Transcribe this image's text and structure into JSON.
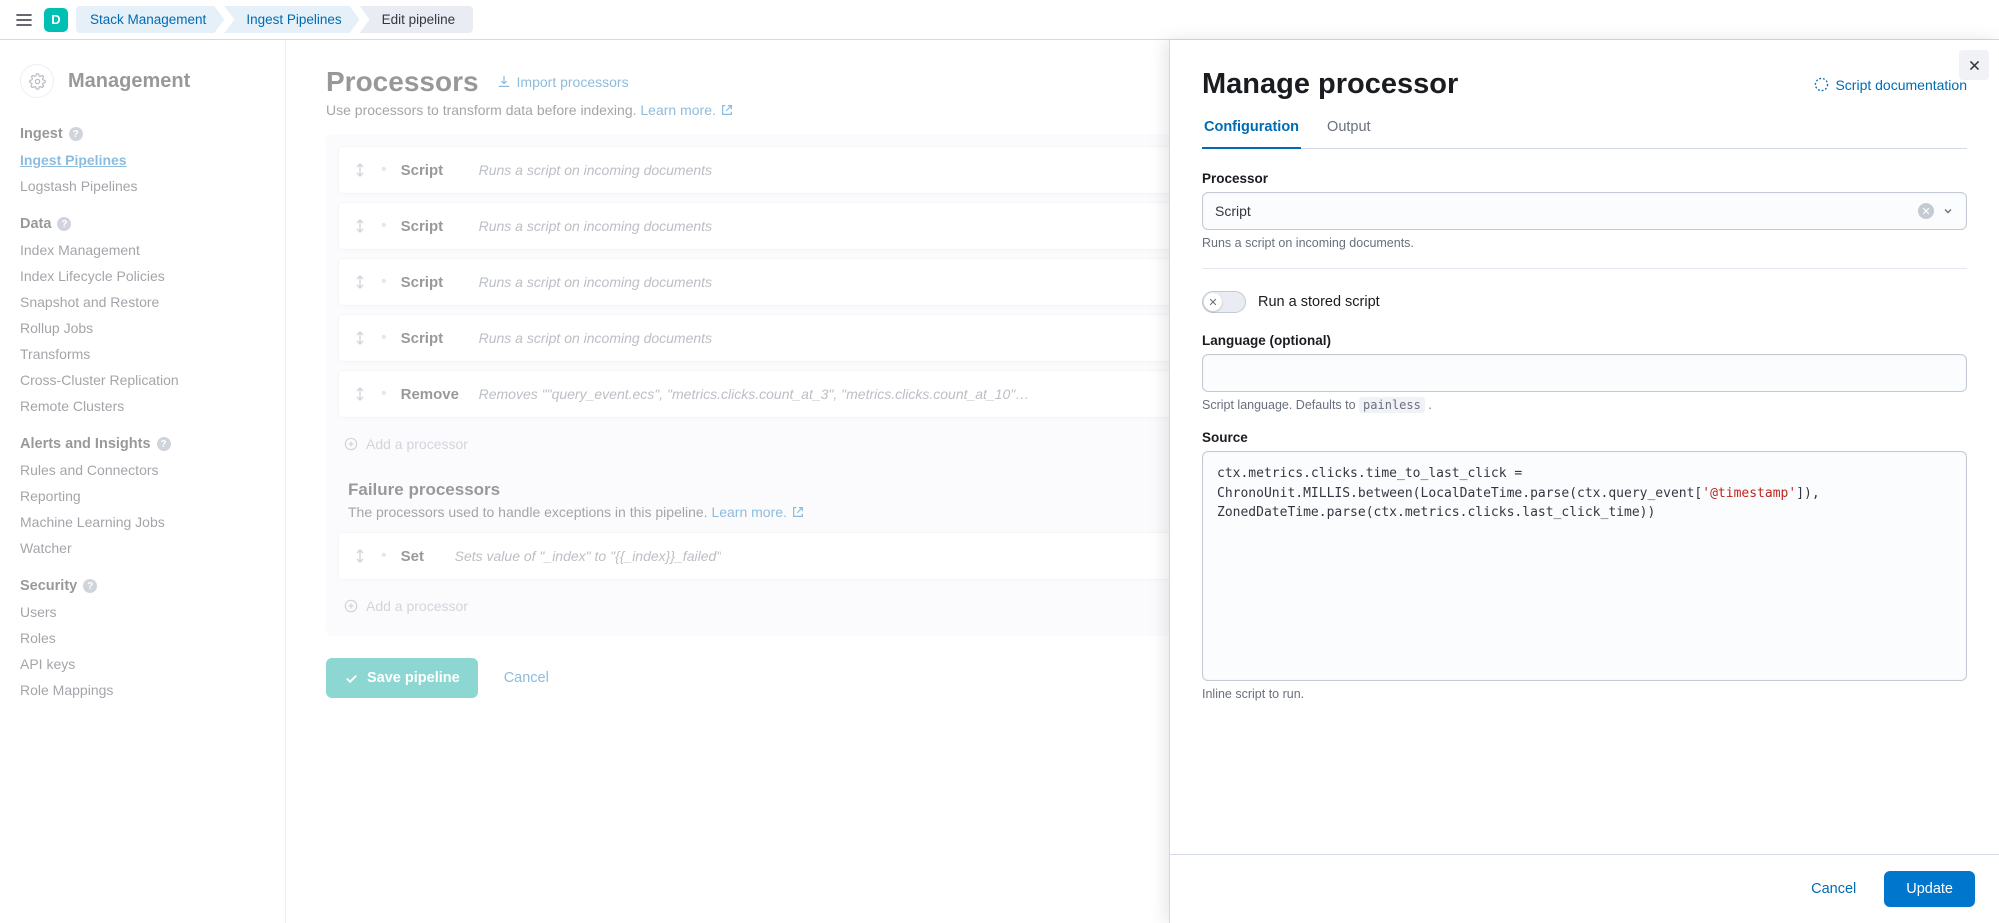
{
  "topnav": {
    "avatar_letter": "D",
    "crumbs": [
      "Stack Management",
      "Ingest Pipelines",
      "Edit pipeline"
    ]
  },
  "sidebar": {
    "title": "Management",
    "sections": [
      {
        "heading": "Ingest",
        "items": [
          {
            "label": "Ingest Pipelines",
            "active": true
          },
          {
            "label": "Logstash Pipelines"
          }
        ]
      },
      {
        "heading": "Data",
        "items": [
          {
            "label": "Index Management"
          },
          {
            "label": "Index Lifecycle Policies"
          },
          {
            "label": "Snapshot and Restore"
          },
          {
            "label": "Rollup Jobs"
          },
          {
            "label": "Transforms"
          },
          {
            "label": "Cross-Cluster Replication"
          },
          {
            "label": "Remote Clusters"
          }
        ]
      },
      {
        "heading": "Alerts and Insights",
        "items": [
          {
            "label": "Rules and Connectors"
          },
          {
            "label": "Reporting"
          },
          {
            "label": "Machine Learning Jobs"
          },
          {
            "label": "Watcher"
          }
        ]
      },
      {
        "heading": "Security",
        "items": [
          {
            "label": "Users"
          },
          {
            "label": "Roles"
          },
          {
            "label": "API keys"
          },
          {
            "label": "Role Mappings"
          }
        ]
      }
    ]
  },
  "main": {
    "title": "Processors",
    "import_label": "Import processors",
    "subtitle": "Use processors to transform data before indexing. ",
    "learn_more": "Learn more.",
    "processors": [
      {
        "name": "Script",
        "desc": "Runs a script on incoming documents"
      },
      {
        "name": "Script",
        "desc": "Runs a script on incoming documents"
      },
      {
        "name": "Script",
        "desc": "Runs a script on incoming documents"
      },
      {
        "name": "Script",
        "desc": "Runs a script on incoming documents"
      },
      {
        "name": "Remove",
        "desc": "Removes \"\"query_event.ecs\", \"metrics.clicks.count_at_3\", \"metrics.clicks.count_at_10\"…"
      }
    ],
    "add_processor": "Add a processor",
    "failure_title": "Failure processors",
    "failure_subtitle": "The processors used to handle exceptions in this pipeline. ",
    "failure_processors": [
      {
        "name": "Set",
        "desc": "Sets value of \"_index\" to \"{{_index}}_failed\""
      }
    ],
    "save_label": "Save pipeline",
    "cancel_label": "Cancel"
  },
  "flyout": {
    "title": "Manage processor",
    "doc_link": "Script documentation",
    "tabs": {
      "configuration": "Configuration",
      "output": "Output"
    },
    "processor_label": "Processor",
    "processor_value": "Script",
    "processor_help": "Runs a script on incoming documents.",
    "toggle_label": "Run a stored script",
    "language_label": "Language (optional)",
    "language_value": "",
    "language_help_pre": "Script language. Defaults to ",
    "language_help_code": "painless",
    "language_help_post": " .",
    "source_label": "Source",
    "source_code_pre": "ctx.metrics.clicks.time_to_last_click = ChronoUnit.MILLIS.between(LocalDateTime.parse(ctx.query_event[",
    "source_code_str": "'@timestamp'",
    "source_code_post": "]), ZonedDateTime.parse(ctx.metrics.clicks.last_click_time))",
    "source_help": "Inline script to run.",
    "cancel_label": "Cancel",
    "update_label": "Update"
  }
}
